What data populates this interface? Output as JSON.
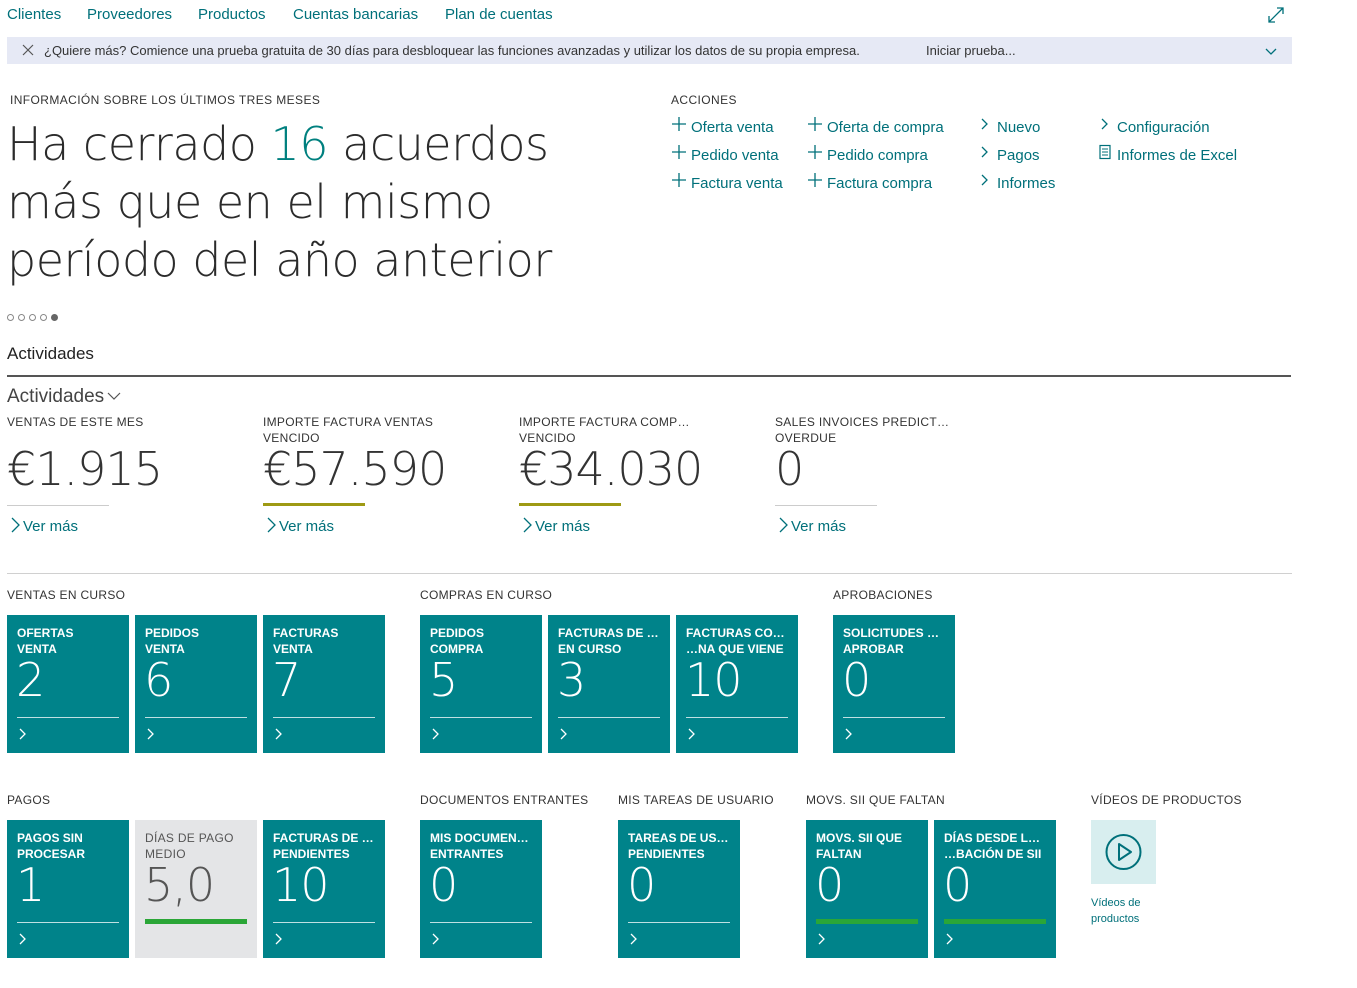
{
  "nav": [
    "Clientes",
    "Proveedores",
    "Productos",
    "Cuentas bancarias",
    "Plan de cuentas"
  ],
  "banner": {
    "message": "¿Quiere más? Comience una prueba gratuita de 30 días para desbloquear las funciones avanzadas y utilizar los datos de su propia empresa.",
    "trial_link": "Iniciar prueba..."
  },
  "insight": {
    "caption": "INFORMACIÓN SOBRE LOS ÚLTIMOS TRES MESES",
    "prefix": "Ha cerrado ",
    "number": "16",
    "suffix": " acuerdos más que en el mismo período del año anterior",
    "dots_total": 5,
    "dots_active": 5
  },
  "actions": {
    "caption": "ACCIONES",
    "items": [
      {
        "label": "Oferta venta",
        "icon": "plus-icon"
      },
      {
        "label": "Pedido venta",
        "icon": "plus-icon"
      },
      {
        "label": "Factura venta",
        "icon": "plus-icon"
      },
      {
        "label": "Oferta de compra",
        "icon": "plus-icon"
      },
      {
        "label": "Pedido compra",
        "icon": "plus-icon"
      },
      {
        "label": "Factura compra",
        "icon": "plus-icon"
      },
      {
        "label": "Nuevo",
        "icon": "chevron-right-icon"
      },
      {
        "label": "Pagos",
        "icon": "chevron-right-icon"
      },
      {
        "label": "Informes",
        "icon": "chevron-right-icon"
      },
      {
        "label": "Configuración",
        "icon": "chevron-right-icon"
      },
      {
        "label": "Informes de Excel",
        "icon": "document-icon"
      }
    ]
  },
  "activities": {
    "title": "Actividades",
    "subtitle": "Actividades",
    "see_more": "Ver más",
    "kpis": [
      {
        "label": "VENTAS DE ESTE MES",
        "value": "€1.915",
        "warning": false
      },
      {
        "label": "IMPORTE FACTURA VENTAS VENCIDO",
        "value": "€57.590",
        "warning": true
      },
      {
        "label": "IMPORTE FACTURA COMP… VENCIDO",
        "value": "€34.030",
        "warning": true
      },
      {
        "label": "SALES INVOICES PREDICT… OVERDUE",
        "value": "0",
        "warning": false
      }
    ]
  },
  "tile_groups": [
    {
      "caption": "VENTAS EN CURSO",
      "tiles": [
        {
          "label": "OFERTAS\nVENTA",
          "value": "2"
        },
        {
          "label": "PEDIDOS\nVENTA",
          "value": "6"
        },
        {
          "label": "FACTURAS\nVENTA",
          "value": "7"
        }
      ]
    },
    {
      "caption": "COMPRAS EN CURSO",
      "tiles": [
        {
          "label": "PEDIDOS\nCOMPRA",
          "value": "5"
        },
        {
          "label": "FACTURAS DE …\nEN CURSO",
          "value": "3"
        },
        {
          "label": "FACTURAS CO…\n…NA QUE VIENE",
          "value": "10"
        }
      ]
    },
    {
      "caption": "APROBACIONES",
      "tiles": [
        {
          "label": "SOLICITUDES …\nAPROBAR",
          "value": "0"
        }
      ]
    },
    {
      "caption": "PAGOS",
      "tiles": [
        {
          "label": "PAGOS SIN\nPROCESAR",
          "value": "1"
        },
        {
          "label": "DÍAS DE PAGO\nMEDIO",
          "value": "5,0",
          "style": "gray",
          "indicator": "green"
        },
        {
          "label": "FACTURAS DE …\nPENDIENTES",
          "value": "10"
        }
      ]
    },
    {
      "caption": "DOCUMENTOS ENTRANTES",
      "tiles": [
        {
          "label": "MIS DOCUMEN…\nENTRANTES",
          "value": "0"
        }
      ]
    },
    {
      "caption": "MIS TAREAS DE USUARIO",
      "tiles": [
        {
          "label": "TAREAS DE US…\nPENDIENTES",
          "value": "0"
        }
      ]
    },
    {
      "caption": "MOVS. SII QUE FALTAN",
      "tiles": [
        {
          "label": "MOVS. SII QUE\nFALTAN",
          "value": "0",
          "indicator": "green"
        },
        {
          "label": "DÍAS DESDE L…\n…BACIÓN DE SII",
          "value": "0",
          "indicator": "green"
        }
      ]
    }
  ],
  "videos": {
    "caption": "VÍDEOS DE PRODUCTOS",
    "tile_label": "Vídeos de productos"
  },
  "colors": {
    "accent": "#00707a",
    "tile": "#00838a",
    "warning": "#9e9a14",
    "good": "#2aa637",
    "banner": "#e6e9f5"
  }
}
